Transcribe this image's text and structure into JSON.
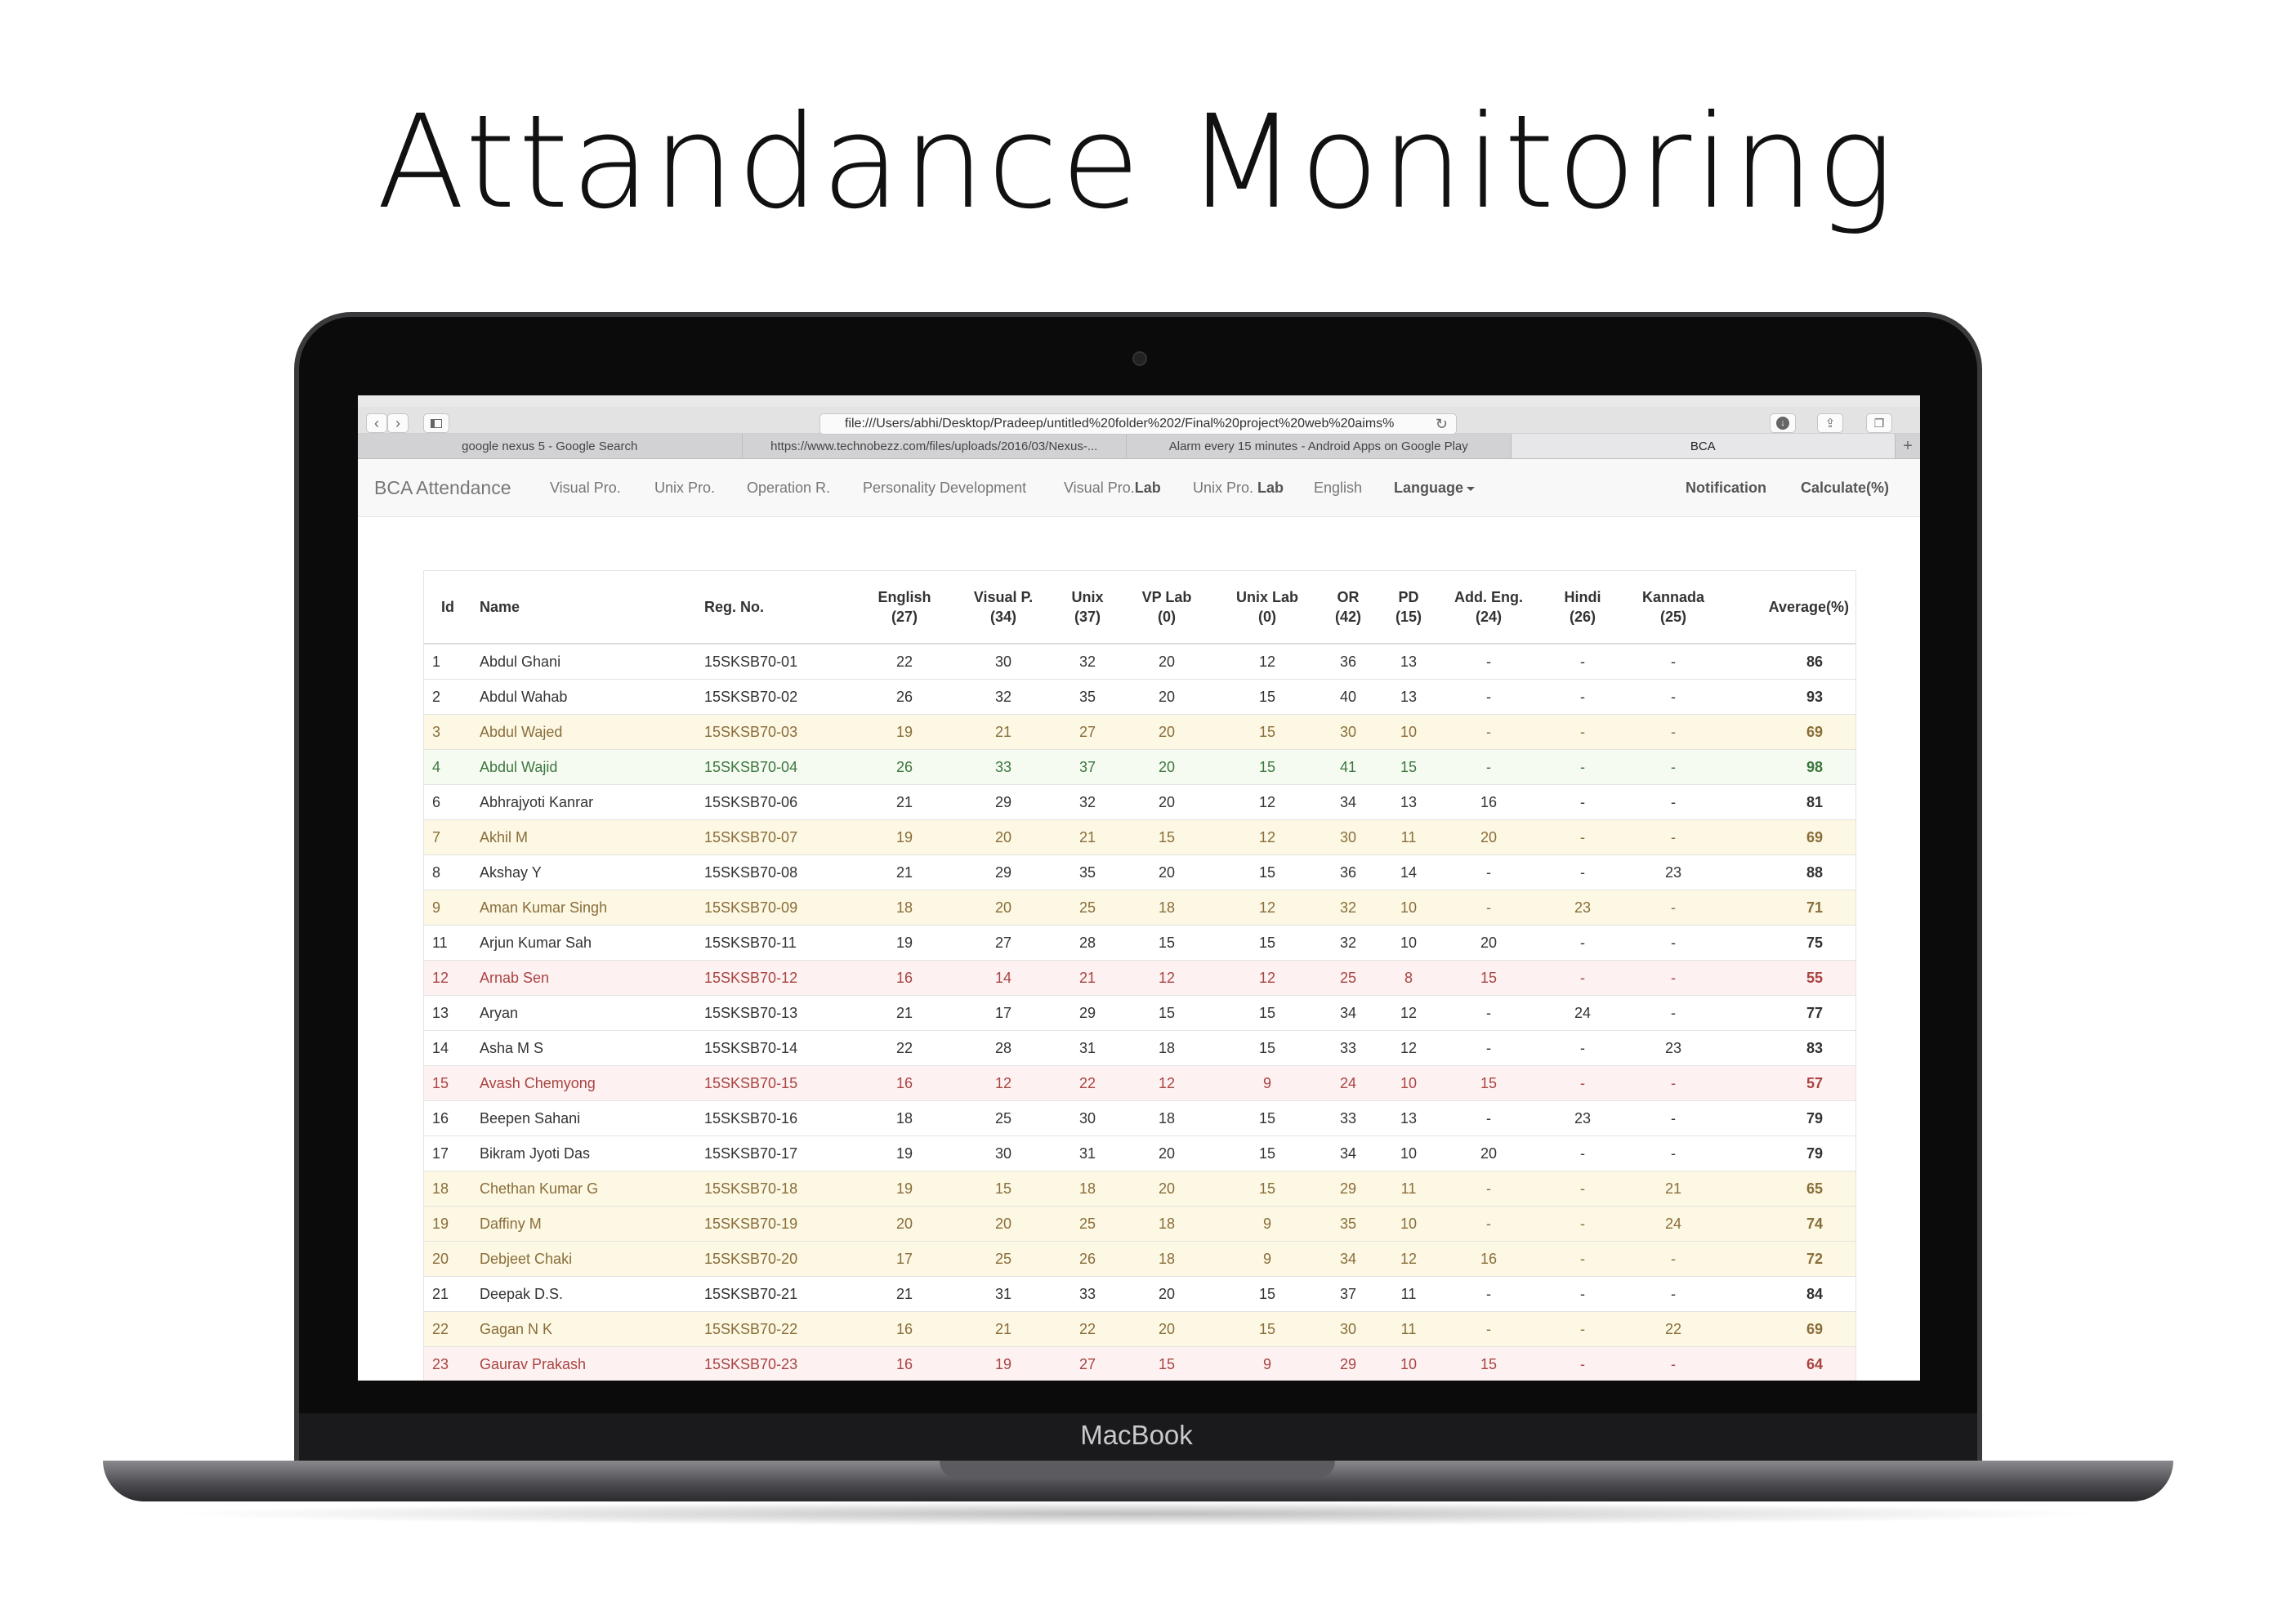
{
  "hero_title": "Attandance Monitoring",
  "device_brand": "MacBook",
  "browser": {
    "url": "file:///Users/abhi/Desktop/Pradeep/untitled%20folder%202/Final%20project%20web%20aims%",
    "tabs": [
      {
        "label": "google nexus 5 - Google Search",
        "active": false
      },
      {
        "label": "https://www.technobezz.com/files/uploads/2016/03/Nexus-...",
        "active": false
      },
      {
        "label": "Alarm every 15 minutes - Android Apps on Google Play",
        "active": false
      },
      {
        "label": "BCA",
        "active": true
      }
    ]
  },
  "navbar": {
    "brand": "BCA Attendance",
    "items": [
      "Visual Pro.",
      "Unix Pro.",
      "Operation R.",
      "Personality Development",
      "Visual Pro.",
      "Unix Pro.",
      "English"
    ],
    "lab_suffix": "Lab",
    "language": "Language",
    "notification": "Notification",
    "calculate": "Calculate(%)"
  },
  "table": {
    "headers": [
      {
        "line1": "Id",
        "line2": ""
      },
      {
        "line1": "Name",
        "line2": ""
      },
      {
        "line1": "Reg. No.",
        "line2": ""
      },
      {
        "line1": "English",
        "line2": "(27)"
      },
      {
        "line1": "Visual P.",
        "line2": "(34)"
      },
      {
        "line1": "Unix",
        "line2": "(37)"
      },
      {
        "line1": "VP Lab",
        "line2": "(0)"
      },
      {
        "line1": "Unix Lab",
        "line2": "(0)"
      },
      {
        "line1": "OR",
        "line2": "(42)"
      },
      {
        "line1": "PD",
        "line2": "(15)"
      },
      {
        "line1": "Add. Eng.",
        "line2": "(24)"
      },
      {
        "line1": "Hindi",
        "line2": "(26)"
      },
      {
        "line1": "Kannada",
        "line2": "(25)"
      },
      {
        "line1": "Average(%)",
        "line2": ""
      }
    ],
    "rows": [
      {
        "status": "",
        "cells": [
          "1",
          "Abdul Ghani",
          "15SKSB70-01",
          "22",
          "30",
          "32",
          "20",
          "12",
          "36",
          "13",
          "-",
          "-",
          "-",
          "86"
        ]
      },
      {
        "status": "",
        "cells": [
          "2",
          "Abdul Wahab",
          "15SKSB70-02",
          "26",
          "32",
          "35",
          "20",
          "15",
          "40",
          "13",
          "-",
          "-",
          "-",
          "93"
        ]
      },
      {
        "status": "warning",
        "cells": [
          "3",
          "Abdul Wajed",
          "15SKSB70-03",
          "19",
          "21",
          "27",
          "20",
          "15",
          "30",
          "10",
          "-",
          "-",
          "-",
          "69"
        ]
      },
      {
        "status": "success",
        "cells": [
          "4",
          "Abdul Wajid",
          "15SKSB70-04",
          "26",
          "33",
          "37",
          "20",
          "15",
          "41",
          "15",
          "-",
          "-",
          "-",
          "98"
        ]
      },
      {
        "status": "",
        "cells": [
          "6",
          "Abhrajyoti Kanrar",
          "15SKSB70-06",
          "21",
          "29",
          "32",
          "20",
          "12",
          "34",
          "13",
          "16",
          "-",
          "-",
          "81"
        ]
      },
      {
        "status": "warning",
        "cells": [
          "7",
          "Akhil M",
          "15SKSB70-07",
          "19",
          "20",
          "21",
          "15",
          "12",
          "30",
          "11",
          "20",
          "-",
          "-",
          "69"
        ]
      },
      {
        "status": "",
        "cells": [
          "8",
          "Akshay Y",
          "15SKSB70-08",
          "21",
          "29",
          "35",
          "20",
          "15",
          "36",
          "14",
          "-",
          "-",
          "23",
          "88"
        ]
      },
      {
        "status": "warning",
        "cells": [
          "9",
          "Aman Kumar Singh",
          "15SKSB70-09",
          "18",
          "20",
          "25",
          "18",
          "12",
          "32",
          "10",
          "-",
          "23",
          "-",
          "71"
        ]
      },
      {
        "status": "",
        "cells": [
          "11",
          "Arjun Kumar Sah",
          "15SKSB70-11",
          "19",
          "27",
          "28",
          "15",
          "15",
          "32",
          "10",
          "20",
          "-",
          "-",
          "75"
        ]
      },
      {
        "status": "danger",
        "cells": [
          "12",
          "Arnab Sen",
          "15SKSB70-12",
          "16",
          "14",
          "21",
          "12",
          "12",
          "25",
          "8",
          "15",
          "-",
          "-",
          "55"
        ]
      },
      {
        "status": "",
        "cells": [
          "13",
          "Aryan",
          "15SKSB70-13",
          "21",
          "17",
          "29",
          "15",
          "15",
          "34",
          "12",
          "-",
          "24",
          "-",
          "77"
        ]
      },
      {
        "status": "",
        "cells": [
          "14",
          "Asha M S",
          "15SKSB70-14",
          "22",
          "28",
          "31",
          "18",
          "15",
          "33",
          "12",
          "-",
          "-",
          "23",
          "83"
        ]
      },
      {
        "status": "danger",
        "cells": [
          "15",
          "Avash Chemyong",
          "15SKSB70-15",
          "16",
          "12",
          "22",
          "12",
          "9",
          "24",
          "10",
          "15",
          "-",
          "-",
          "57"
        ]
      },
      {
        "status": "",
        "cells": [
          "16",
          "Beepen Sahani",
          "15SKSB70-16",
          "18",
          "25",
          "30",
          "18",
          "15",
          "33",
          "13",
          "-",
          "23",
          "-",
          "79"
        ]
      },
      {
        "status": "",
        "cells": [
          "17",
          "Bikram Jyoti Das",
          "15SKSB70-17",
          "19",
          "30",
          "31",
          "20",
          "15",
          "34",
          "10",
          "20",
          "-",
          "-",
          "79"
        ]
      },
      {
        "status": "warning",
        "cells": [
          "18",
          "Chethan Kumar G",
          "15SKSB70-18",
          "19",
          "15",
          "18",
          "20",
          "15",
          "29",
          "11",
          "-",
          "-",
          "21",
          "65"
        ]
      },
      {
        "status": "warning",
        "cells": [
          "19",
          "Daffiny M",
          "15SKSB70-19",
          "20",
          "20",
          "25",
          "18",
          "9",
          "35",
          "10",
          "-",
          "-",
          "24",
          "74"
        ]
      },
      {
        "status": "warning",
        "cells": [
          "20",
          "Debjeet Chaki",
          "15SKSB70-20",
          "17",
          "25",
          "26",
          "18",
          "9",
          "34",
          "12",
          "16",
          "-",
          "-",
          "72"
        ]
      },
      {
        "status": "",
        "cells": [
          "21",
          "Deepak D.S.",
          "15SKSB70-21",
          "21",
          "31",
          "33",
          "20",
          "15",
          "37",
          "11",
          "-",
          "-",
          "-",
          "84"
        ]
      },
      {
        "status": "warning",
        "cells": [
          "22",
          "Gagan N K",
          "15SKSB70-22",
          "16",
          "21",
          "22",
          "20",
          "15",
          "30",
          "11",
          "-",
          "-",
          "22",
          "69"
        ]
      },
      {
        "status": "danger",
        "cells": [
          "23",
          "Gaurav Prakash",
          "15SKSB70-23",
          "16",
          "19",
          "27",
          "15",
          "9",
          "29",
          "10",
          "15",
          "-",
          "-",
          "64"
        ]
      }
    ]
  }
}
